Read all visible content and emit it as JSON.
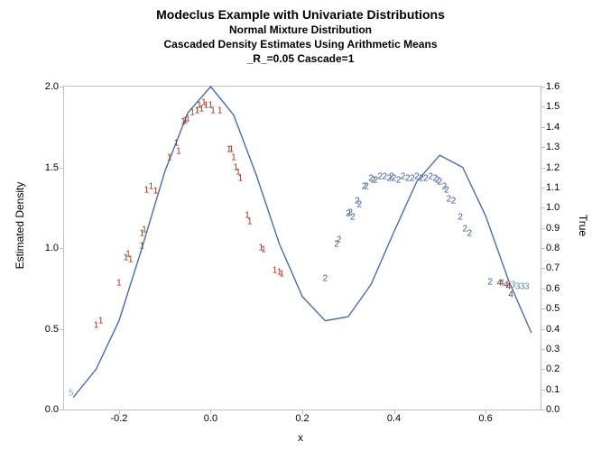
{
  "chart_data": {
    "type": "scatter",
    "title": "Modeclus Example with Univariate Distributions",
    "subtitle1": "Normal Mixture Distribution",
    "subtitle2": "Cascaded Density Estimates Using Arithmetic Means",
    "subtitle3": "_R_=0.05 Cascade=1",
    "xlabel": "x",
    "ylabel_left": "Estimated Density",
    "ylabel_right": "True",
    "xlim": [
      -0.32,
      0.72
    ],
    "ylim_left": [
      0.0,
      2.0
    ],
    "ylim_right": [
      0.0,
      1.6
    ],
    "xticks": [
      -0.2,
      0.0,
      0.2,
      0.4,
      0.6
    ],
    "yticks_left": [
      0.0,
      0.5,
      1.0,
      1.5,
      2.0
    ],
    "yticks_right": [
      0.0,
      0.1,
      0.2,
      0.3,
      0.4,
      0.5,
      0.6,
      0.7,
      0.8,
      0.9,
      1.0,
      1.1,
      1.2,
      1.3,
      1.4,
      1.5,
      1.6
    ],
    "curve": [
      {
        "x": -0.3,
        "true": 0.06
      },
      {
        "x": -0.25,
        "true": 0.2
      },
      {
        "x": -0.2,
        "true": 0.44
      },
      {
        "x": -0.15,
        "true": 0.8
      },
      {
        "x": -0.1,
        "true": 1.18
      },
      {
        "x": -0.05,
        "true": 1.47
      },
      {
        "x": 0.0,
        "true": 1.6
      },
      {
        "x": 0.05,
        "true": 1.46
      },
      {
        "x": 0.1,
        "true": 1.16
      },
      {
        "x": 0.15,
        "true": 0.82
      },
      {
        "x": 0.2,
        "true": 0.56
      },
      {
        "x": 0.25,
        "true": 0.44
      },
      {
        "x": 0.3,
        "true": 0.46
      },
      {
        "x": 0.35,
        "true": 0.62
      },
      {
        "x": 0.4,
        "true": 0.88
      },
      {
        "x": 0.45,
        "true": 1.13
      },
      {
        "x": 0.5,
        "true": 1.26
      },
      {
        "x": 0.55,
        "true": 1.2
      },
      {
        "x": 0.6,
        "true": 0.96
      },
      {
        "x": 0.65,
        "true": 0.64
      },
      {
        "x": 0.7,
        "true": 0.38
      }
    ],
    "points": [
      {
        "x": -0.305,
        "est": 0.1,
        "cluster": 5
      },
      {
        "x": -0.25,
        "est": 0.52,
        "cluster": 1
      },
      {
        "x": -0.24,
        "est": 0.55,
        "cluster": 1
      },
      {
        "x": -0.2,
        "est": 0.78,
        "cluster": 1
      },
      {
        "x": -0.185,
        "est": 0.94,
        "cluster": 1
      },
      {
        "x": -0.18,
        "est": 0.96,
        "cluster": 1
      },
      {
        "x": -0.175,
        "est": 0.93,
        "cluster": 1
      },
      {
        "x": -0.15,
        "est": 1.01,
        "cluster": 1
      },
      {
        "x": -0.15,
        "est": 1.09,
        "cluster": 1
      },
      {
        "x": -0.145,
        "est": 1.11,
        "cluster": 1
      },
      {
        "x": -0.14,
        "est": 1.36,
        "cluster": 1
      },
      {
        "x": -0.13,
        "est": 1.38,
        "cluster": 1
      },
      {
        "x": -0.12,
        "est": 1.35,
        "cluster": 1
      },
      {
        "x": -0.09,
        "est": 1.56,
        "cluster": 1
      },
      {
        "x": -0.075,
        "est": 1.65,
        "cluster": 1
      },
      {
        "x": -0.07,
        "est": 1.6,
        "cluster": 1
      },
      {
        "x": -0.06,
        "est": 1.78,
        "cluster": 1
      },
      {
        "x": -0.055,
        "est": 1.79,
        "cluster": 1
      },
      {
        "x": -0.05,
        "est": 1.8,
        "cluster": 1
      },
      {
        "x": -0.04,
        "est": 1.84,
        "cluster": 1
      },
      {
        "x": -0.03,
        "est": 1.85,
        "cluster": 1
      },
      {
        "x": -0.025,
        "est": 1.88,
        "cluster": 1
      },
      {
        "x": -0.02,
        "est": 1.86,
        "cluster": 1
      },
      {
        "x": -0.015,
        "est": 1.9,
        "cluster": 1
      },
      {
        "x": -0.01,
        "est": 1.88,
        "cluster": 1
      },
      {
        "x": 0.0,
        "est": 1.88,
        "cluster": 1
      },
      {
        "x": 0.005,
        "est": 1.85,
        "cluster": 1
      },
      {
        "x": 0.02,
        "est": 1.85,
        "cluster": 1
      },
      {
        "x": 0.04,
        "est": 1.61,
        "cluster": 1
      },
      {
        "x": 0.045,
        "est": 1.61,
        "cluster": 1
      },
      {
        "x": 0.05,
        "est": 1.56,
        "cluster": 1
      },
      {
        "x": 0.055,
        "est": 1.5,
        "cluster": 1
      },
      {
        "x": 0.06,
        "est": 1.47,
        "cluster": 1
      },
      {
        "x": 0.065,
        "est": 1.43,
        "cluster": 1
      },
      {
        "x": 0.08,
        "est": 1.2,
        "cluster": 1
      },
      {
        "x": 0.085,
        "est": 1.16,
        "cluster": 1
      },
      {
        "x": 0.11,
        "est": 1.0,
        "cluster": 1
      },
      {
        "x": 0.115,
        "est": 0.99,
        "cluster": 1
      },
      {
        "x": 0.14,
        "est": 0.86,
        "cluster": 1
      },
      {
        "x": 0.15,
        "est": 0.85,
        "cluster": 1
      },
      {
        "x": 0.155,
        "est": 0.84,
        "cluster": 1
      },
      {
        "x": 0.25,
        "est": 0.81,
        "cluster": 2
      },
      {
        "x": 0.275,
        "est": 1.02,
        "cluster": 2
      },
      {
        "x": 0.28,
        "est": 1.05,
        "cluster": 2
      },
      {
        "x": 0.3,
        "est": 1.21,
        "cluster": 2
      },
      {
        "x": 0.305,
        "est": 1.22,
        "cluster": 2
      },
      {
        "x": 0.31,
        "est": 1.19,
        "cluster": 2
      },
      {
        "x": 0.32,
        "est": 1.29,
        "cluster": 2
      },
      {
        "x": 0.325,
        "est": 1.27,
        "cluster": 2
      },
      {
        "x": 0.335,
        "est": 1.38,
        "cluster": 2
      },
      {
        "x": 0.34,
        "est": 1.38,
        "cluster": 2
      },
      {
        "x": 0.35,
        "est": 1.43,
        "cluster": 2
      },
      {
        "x": 0.355,
        "est": 1.42,
        "cluster": 2
      },
      {
        "x": 0.36,
        "est": 1.42,
        "cluster": 2
      },
      {
        "x": 0.37,
        "est": 1.44,
        "cluster": 2
      },
      {
        "x": 0.38,
        "est": 1.44,
        "cluster": 2
      },
      {
        "x": 0.39,
        "est": 1.43,
        "cluster": 2
      },
      {
        "x": 0.395,
        "est": 1.44,
        "cluster": 2
      },
      {
        "x": 0.4,
        "est": 1.43,
        "cluster": 2
      },
      {
        "x": 0.41,
        "est": 1.42,
        "cluster": 2
      },
      {
        "x": 0.42,
        "est": 1.44,
        "cluster": 2
      },
      {
        "x": 0.43,
        "est": 1.43,
        "cluster": 2
      },
      {
        "x": 0.44,
        "est": 1.43,
        "cluster": 2
      },
      {
        "x": 0.45,
        "est": 1.44,
        "cluster": 2
      },
      {
        "x": 0.46,
        "est": 1.43,
        "cluster": 2
      },
      {
        "x": 0.47,
        "est": 1.43,
        "cluster": 2
      },
      {
        "x": 0.48,
        "est": 1.44,
        "cluster": 2
      },
      {
        "x": 0.49,
        "est": 1.43,
        "cluster": 2
      },
      {
        "x": 0.495,
        "est": 1.42,
        "cluster": 2
      },
      {
        "x": 0.5,
        "est": 1.41,
        "cluster": 2
      },
      {
        "x": 0.51,
        "est": 1.38,
        "cluster": 2
      },
      {
        "x": 0.515,
        "est": 1.36,
        "cluster": 2
      },
      {
        "x": 0.52,
        "est": 1.3,
        "cluster": 2
      },
      {
        "x": 0.53,
        "est": 1.29,
        "cluster": 2
      },
      {
        "x": 0.545,
        "est": 1.19,
        "cluster": 2
      },
      {
        "x": 0.555,
        "est": 1.12,
        "cluster": 2
      },
      {
        "x": 0.565,
        "est": 1.09,
        "cluster": 2
      },
      {
        "x": 0.61,
        "est": 0.79,
        "cluster": 2
      },
      {
        "x": 0.63,
        "est": 0.78,
        "cluster": 4
      },
      {
        "x": 0.635,
        "est": 0.78,
        "cluster": 4
      },
      {
        "x": 0.645,
        "est": 0.77,
        "cluster": 4
      },
      {
        "x": 0.65,
        "est": 0.76,
        "cluster": 4
      },
      {
        "x": 0.655,
        "est": 0.71,
        "cluster": 4
      },
      {
        "x": 0.66,
        "est": 0.77,
        "cluster": 3
      },
      {
        "x": 0.67,
        "est": 0.76,
        "cluster": 3
      },
      {
        "x": 0.68,
        "est": 0.76,
        "cluster": 3
      },
      {
        "x": 0.69,
        "est": 0.76,
        "cluster": 3
      }
    ],
    "curve_color": "#4a6da7"
  }
}
